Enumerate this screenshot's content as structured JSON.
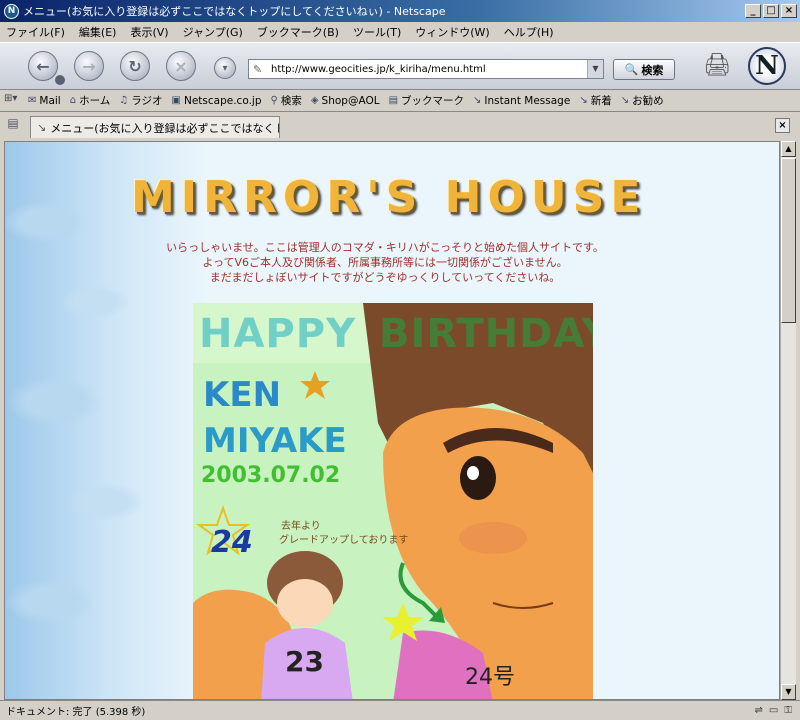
{
  "window": {
    "title": "メニュー(お気に入り登録は必ずここではなくトップにしてくださいねぃ) - Netscape",
    "app_icon": "netscape-icon",
    "buttons": [
      "_",
      "□",
      "×"
    ]
  },
  "menu": {
    "items": [
      "ファイル(F)",
      "編集(E)",
      "表示(V)",
      "ジャンプ(G)",
      "ブックマーク(B)",
      "ツール(T)",
      "ウィンドウ(W)",
      "ヘルプ(H)"
    ]
  },
  "navigation": {
    "url": "http://www.geocities.jp/k_kiriha/menu.html",
    "search_label": "検索"
  },
  "personal_toolbar": {
    "items": [
      {
        "icon": "mail-icon",
        "label": "Mail"
      },
      {
        "icon": "home-icon",
        "label": "ホーム"
      },
      {
        "icon": "radio-icon",
        "label": "ラジオ"
      },
      {
        "icon": "my-icon",
        "label": "Netscape.co.jp"
      },
      {
        "icon": "search-icon",
        "label": "検索"
      },
      {
        "icon": "shop-icon",
        "label": "Shop@AOL"
      },
      {
        "icon": "bookmark-icon",
        "label": "ブックマーク"
      },
      {
        "icon": "link-icon",
        "label": "Instant Message"
      },
      {
        "icon": "link-icon",
        "label": "新着"
      },
      {
        "icon": "link-icon",
        "label": "お勧め"
      }
    ]
  },
  "tab": {
    "label": "メニュー(お気に入り登録は必ずここではなくト..."
  },
  "page": {
    "site_title": "MIRROR'S HOUSE",
    "intro_lines": [
      "いらっしゃいませ。ここは管理人のコマダ・キリハがこっそりと始めた個人サイトです。",
      "よってV6ご本人及び関係者、所属事務所等には一切関係がございません。",
      "まだまだしょぼいサイトですがどうぞゆっくりしていってくださいね。"
    ],
    "illustration": {
      "happy": "HAPPY",
      "birthday": "BIRTHDAY",
      "name1": "KEN",
      "name2": "MIYAKE",
      "date": "2003.07.02",
      "age": "24",
      "note1": "去年より",
      "note2": "グレードアップしております",
      "shirt_small": "23",
      "shirt_big": "24号"
    }
  },
  "status": {
    "text": "ドキュメント: 完了 (5.398 秒)"
  }
}
